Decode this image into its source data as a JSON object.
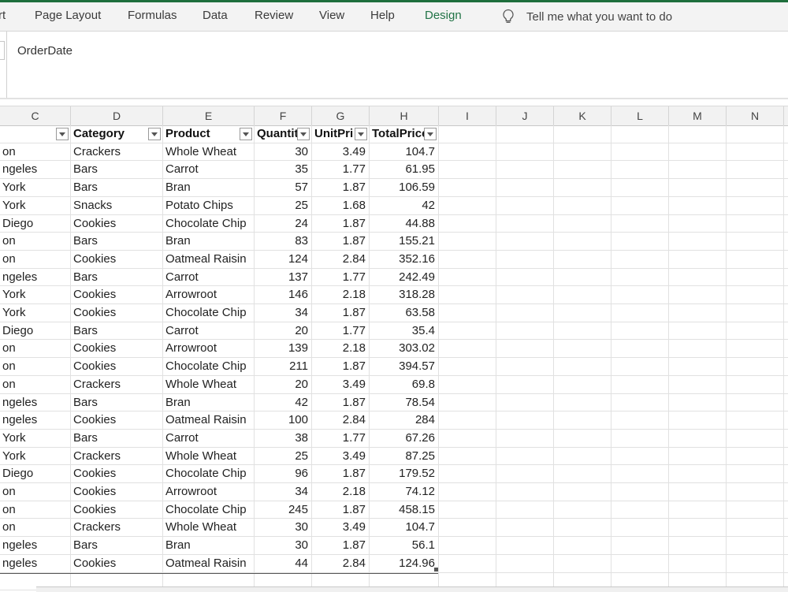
{
  "ribbon": {
    "tabs": [
      "rt",
      "Page Layout",
      "Formulas",
      "Data",
      "Review",
      "View",
      "Help",
      "Design"
    ],
    "tell_me": "Tell me what you want to do"
  },
  "formula_bar": {
    "content": "OrderDate"
  },
  "columns": [
    "C",
    "D",
    "E",
    "F",
    "G",
    "H",
    "I",
    "J",
    "K",
    "L",
    "M",
    "N"
  ],
  "table": {
    "headers": [
      "",
      "Category",
      "Product",
      "Quantit",
      "UnitPri",
      "TotalPrice"
    ],
    "rows": [
      [
        "on",
        "Crackers",
        "Whole Wheat",
        "30",
        "3.49",
        "104.7"
      ],
      [
        "ngeles",
        "Bars",
        "Carrot",
        "35",
        "1.77",
        "61.95"
      ],
      [
        " York",
        "Bars",
        "Bran",
        "57",
        "1.87",
        "106.59"
      ],
      [
        " York",
        "Snacks",
        "Potato Chips",
        "25",
        "1.68",
        "42"
      ],
      [
        "Diego",
        "Cookies",
        "Chocolate Chip",
        "24",
        "1.87",
        "44.88"
      ],
      [
        "on",
        "Bars",
        "Bran",
        "83",
        "1.87",
        "155.21"
      ],
      [
        "on",
        "Cookies",
        "Oatmeal Raisin",
        "124",
        "2.84",
        "352.16"
      ],
      [
        "ngeles",
        "Bars",
        "Carrot",
        "137",
        "1.77",
        "242.49"
      ],
      [
        " York",
        "Cookies",
        "Arrowroot",
        "146",
        "2.18",
        "318.28"
      ],
      [
        " York",
        "Cookies",
        "Chocolate Chip",
        "34",
        "1.87",
        "63.58"
      ],
      [
        "Diego",
        "Bars",
        "Carrot",
        "20",
        "1.77",
        "35.4"
      ],
      [
        "on",
        "Cookies",
        "Arrowroot",
        "139",
        "2.18",
        "303.02"
      ],
      [
        "on",
        "Cookies",
        "Chocolate Chip",
        "211",
        "1.87",
        "394.57"
      ],
      [
        "on",
        "Crackers",
        "Whole Wheat",
        "20",
        "3.49",
        "69.8"
      ],
      [
        "ngeles",
        "Bars",
        "Bran",
        "42",
        "1.87",
        "78.54"
      ],
      [
        "ngeles",
        "Cookies",
        "Oatmeal Raisin",
        "100",
        "2.84",
        "284"
      ],
      [
        " York",
        "Bars",
        "Carrot",
        "38",
        "1.77",
        "67.26"
      ],
      [
        " York",
        "Crackers",
        "Whole Wheat",
        "25",
        "3.49",
        "87.25"
      ],
      [
        "Diego",
        "Cookies",
        "Chocolate Chip",
        "96",
        "1.87",
        "179.52"
      ],
      [
        "on",
        "Cookies",
        "Arrowroot",
        "34",
        "2.18",
        "74.12"
      ],
      [
        "on",
        "Cookies",
        "Chocolate Chip",
        "245",
        "1.87",
        "458.15"
      ],
      [
        "on",
        "Crackers",
        "Whole Wheat",
        "30",
        "3.49",
        "104.7"
      ],
      [
        "ngeles",
        "Bars",
        "Bran",
        "30",
        "1.87",
        "56.1"
      ],
      [
        "ngeles",
        "Cookies",
        "Oatmeal Raisin",
        "44",
        "2.84",
        "124.96"
      ]
    ]
  },
  "icons": {
    "tell_me": "lightbulb-icon",
    "filter": "filter-dropdown-icon"
  },
  "colors": {
    "accent": "#217346",
    "header_bg": "#f2f2f2",
    "gridline": "#e1e1e1"
  }
}
